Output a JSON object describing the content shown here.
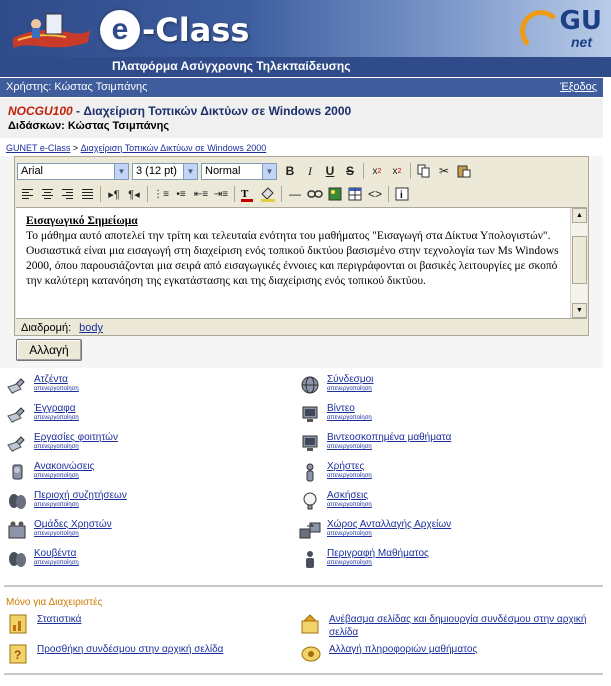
{
  "header": {
    "logo_e": "e",
    "logo_text": "-Class",
    "subtitle": "Πλατφόρμα Ασύγχρονης Τηλεκπαίδευσης",
    "gu_logo": "GU",
    "gu_net": "net"
  },
  "userbar": {
    "user": "Χρήστης: Κώστας Τσιμπάνης",
    "logout": "Έξοδος"
  },
  "course": {
    "code": "NOCGU100",
    "title": " - Διαχείριση Τοπικών Δικτύων σε Windows 2000",
    "instructor": "Διδάσκων: Κώστας Τσιμπάνης"
  },
  "breadcrumb": {
    "home": "GUNET e-Class",
    "sep": " > ",
    "current": "Διαχείριση Τοπικών Δικτύων σε Windows 2000"
  },
  "editor": {
    "font": "Arial",
    "size": "3 (12 pt)",
    "format": "Normal",
    "heading": "Εισαγωγικό Σημείωμα",
    "body": "Το μάθημα αυτό αποτελεί την τρίτη και τελευταία ενότητα του μαθήματος \"Εισαγωγή στα Δίκτυα Υπολογιστών\". Ουσιαστικά είναι μια εισαγωγή στη διαχείριση ενός τοπικού δικτύου βασισμένο στην τεχνολογία των Ms Windows 2000, όπου παρουσιάζονται μια σειρά από εισαγωγικές έννοιες και περιγράφονται οι βασικές λειτουργίες με σκοπό την καλύτερη κατανόηση της εγκατάστασης και της διαχείρισης ενός τοπικού δικτύου.",
    "path_label": "Διαδρομή:",
    "path_link": "body",
    "submit": "Αλλαγή"
  },
  "tools": {
    "sub": "απενεργοποίηση",
    "left": [
      "Ατζέντα",
      "Έγγραφα",
      "Εργασίες φοιτητών",
      "Ανακοινώσεις",
      "Περιοχή συζητήσεων",
      "Ομάδες Χρηστών",
      "Κουβέντα"
    ],
    "right": [
      "Σύνδεσμοι",
      "Βίντεο",
      "Βιντεοσκοπημένα μαθήματα",
      "Χρήστες",
      "Ασκήσεις",
      "Χώρος Ανταλλαγής Αρχείων",
      "Περιγραφή Μαθήματος"
    ]
  },
  "admin": {
    "title": "Μόνο για Διαχειριστές",
    "items": [
      "Στατιστικά",
      "Ανέβασμα σελίδας και δημιουργία συνδέσμου στην αρχική σελίδα",
      "Προσθήκη συνδέσμου στην αρχική σελίδα",
      "Αλλαγή πληροφοριών μαθήματος"
    ]
  }
}
